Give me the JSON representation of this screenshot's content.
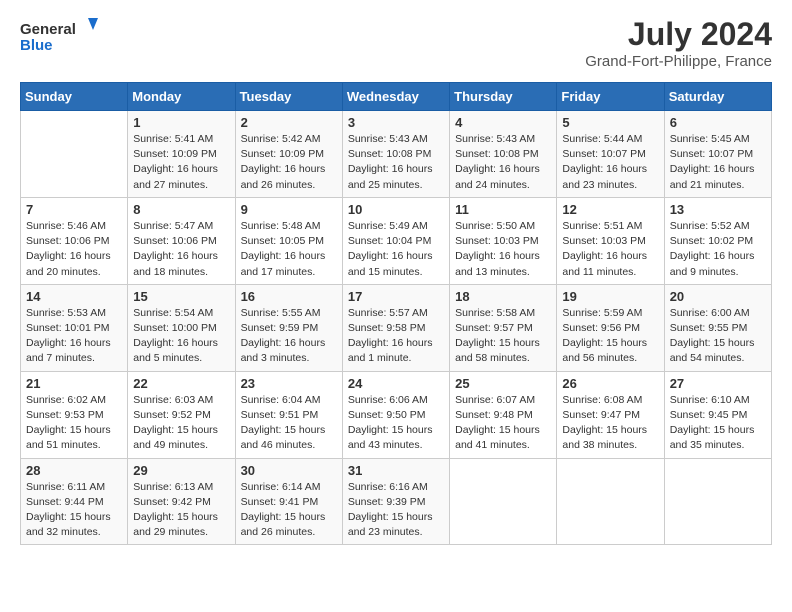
{
  "header": {
    "logo_general": "General",
    "logo_blue": "Blue",
    "month_year": "July 2024",
    "location": "Grand-Fort-Philippe, France"
  },
  "days_of_week": [
    "Sunday",
    "Monday",
    "Tuesday",
    "Wednesday",
    "Thursday",
    "Friday",
    "Saturday"
  ],
  "weeks": [
    [
      {
        "day": "",
        "info": ""
      },
      {
        "day": "1",
        "info": "Sunrise: 5:41 AM\nSunset: 10:09 PM\nDaylight: 16 hours\nand 27 minutes."
      },
      {
        "day": "2",
        "info": "Sunrise: 5:42 AM\nSunset: 10:09 PM\nDaylight: 16 hours\nand 26 minutes."
      },
      {
        "day": "3",
        "info": "Sunrise: 5:43 AM\nSunset: 10:08 PM\nDaylight: 16 hours\nand 25 minutes."
      },
      {
        "day": "4",
        "info": "Sunrise: 5:43 AM\nSunset: 10:08 PM\nDaylight: 16 hours\nand 24 minutes."
      },
      {
        "day": "5",
        "info": "Sunrise: 5:44 AM\nSunset: 10:07 PM\nDaylight: 16 hours\nand 23 minutes."
      },
      {
        "day": "6",
        "info": "Sunrise: 5:45 AM\nSunset: 10:07 PM\nDaylight: 16 hours\nand 21 minutes."
      }
    ],
    [
      {
        "day": "7",
        "info": "Sunrise: 5:46 AM\nSunset: 10:06 PM\nDaylight: 16 hours\nand 20 minutes."
      },
      {
        "day": "8",
        "info": "Sunrise: 5:47 AM\nSunset: 10:06 PM\nDaylight: 16 hours\nand 18 minutes."
      },
      {
        "day": "9",
        "info": "Sunrise: 5:48 AM\nSunset: 10:05 PM\nDaylight: 16 hours\nand 17 minutes."
      },
      {
        "day": "10",
        "info": "Sunrise: 5:49 AM\nSunset: 10:04 PM\nDaylight: 16 hours\nand 15 minutes."
      },
      {
        "day": "11",
        "info": "Sunrise: 5:50 AM\nSunset: 10:03 PM\nDaylight: 16 hours\nand 13 minutes."
      },
      {
        "day": "12",
        "info": "Sunrise: 5:51 AM\nSunset: 10:03 PM\nDaylight: 16 hours\nand 11 minutes."
      },
      {
        "day": "13",
        "info": "Sunrise: 5:52 AM\nSunset: 10:02 PM\nDaylight: 16 hours\nand 9 minutes."
      }
    ],
    [
      {
        "day": "14",
        "info": "Sunrise: 5:53 AM\nSunset: 10:01 PM\nDaylight: 16 hours\nand 7 minutes."
      },
      {
        "day": "15",
        "info": "Sunrise: 5:54 AM\nSunset: 10:00 PM\nDaylight: 16 hours\nand 5 minutes."
      },
      {
        "day": "16",
        "info": "Sunrise: 5:55 AM\nSunset: 9:59 PM\nDaylight: 16 hours\nand 3 minutes."
      },
      {
        "day": "17",
        "info": "Sunrise: 5:57 AM\nSunset: 9:58 PM\nDaylight: 16 hours\nand 1 minute."
      },
      {
        "day": "18",
        "info": "Sunrise: 5:58 AM\nSunset: 9:57 PM\nDaylight: 15 hours\nand 58 minutes."
      },
      {
        "day": "19",
        "info": "Sunrise: 5:59 AM\nSunset: 9:56 PM\nDaylight: 15 hours\nand 56 minutes."
      },
      {
        "day": "20",
        "info": "Sunrise: 6:00 AM\nSunset: 9:55 PM\nDaylight: 15 hours\nand 54 minutes."
      }
    ],
    [
      {
        "day": "21",
        "info": "Sunrise: 6:02 AM\nSunset: 9:53 PM\nDaylight: 15 hours\nand 51 minutes."
      },
      {
        "day": "22",
        "info": "Sunrise: 6:03 AM\nSunset: 9:52 PM\nDaylight: 15 hours\nand 49 minutes."
      },
      {
        "day": "23",
        "info": "Sunrise: 6:04 AM\nSunset: 9:51 PM\nDaylight: 15 hours\nand 46 minutes."
      },
      {
        "day": "24",
        "info": "Sunrise: 6:06 AM\nSunset: 9:50 PM\nDaylight: 15 hours\nand 43 minutes."
      },
      {
        "day": "25",
        "info": "Sunrise: 6:07 AM\nSunset: 9:48 PM\nDaylight: 15 hours\nand 41 minutes."
      },
      {
        "day": "26",
        "info": "Sunrise: 6:08 AM\nSunset: 9:47 PM\nDaylight: 15 hours\nand 38 minutes."
      },
      {
        "day": "27",
        "info": "Sunrise: 6:10 AM\nSunset: 9:45 PM\nDaylight: 15 hours\nand 35 minutes."
      }
    ],
    [
      {
        "day": "28",
        "info": "Sunrise: 6:11 AM\nSunset: 9:44 PM\nDaylight: 15 hours\nand 32 minutes."
      },
      {
        "day": "29",
        "info": "Sunrise: 6:13 AM\nSunset: 9:42 PM\nDaylight: 15 hours\nand 29 minutes."
      },
      {
        "day": "30",
        "info": "Sunrise: 6:14 AM\nSunset: 9:41 PM\nDaylight: 15 hours\nand 26 minutes."
      },
      {
        "day": "31",
        "info": "Sunrise: 6:16 AM\nSunset: 9:39 PM\nDaylight: 15 hours\nand 23 minutes."
      },
      {
        "day": "",
        "info": ""
      },
      {
        "day": "",
        "info": ""
      },
      {
        "day": "",
        "info": ""
      }
    ]
  ]
}
